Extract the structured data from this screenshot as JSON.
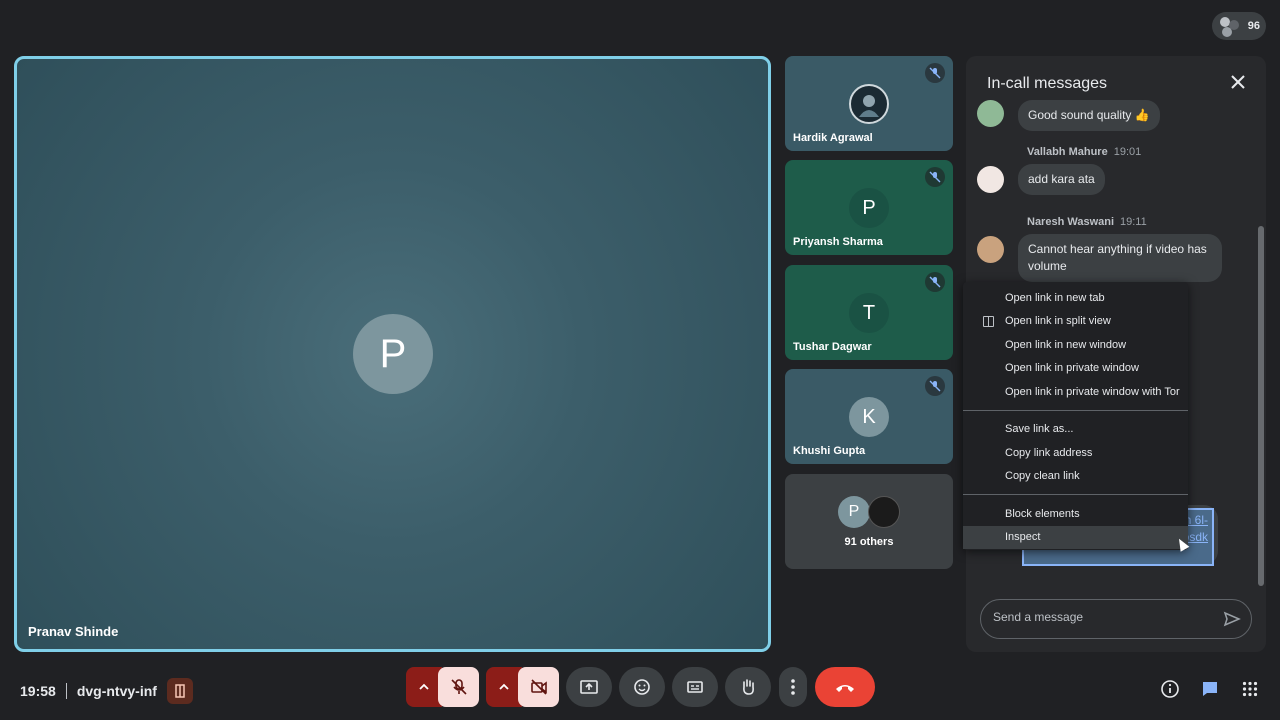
{
  "participants_badge": {
    "count": "96"
  },
  "main_tile": {
    "initial": "P",
    "name": "Pranav Shinde"
  },
  "tiles": [
    {
      "name": "Hardik Agrawal",
      "initial": "",
      "bg": "#3a5a66"
    },
    {
      "name": "Priyansh Sharma",
      "initial": "P",
      "bg": "#1e5c4a"
    },
    {
      "name": "Tushar Dagwar",
      "initial": "T",
      "bg": "#1e5c4a"
    },
    {
      "name": "Khushi Gupta",
      "initial": "K",
      "bg": "#3a5a66"
    }
  ],
  "others_tile": {
    "label": "91 others",
    "initial": "P"
  },
  "chat": {
    "title": "In-call messages",
    "messages": [
      {
        "text": "Good sound quality 👍"
      },
      {
        "sender": "Vallabh Mahure",
        "time": "19:01",
        "text": "add kara ata"
      },
      {
        "sender": "Naresh Waswani",
        "time": "19:11",
        "text": "Cannot hear anything if video has volume"
      }
    ],
    "link_text": "//lhm 6l- ...ujbAmraraakwaraqp=ahosdk",
    "input_placeholder": "Send a message"
  },
  "context_menu": {
    "group1": [
      "Open link in new tab",
      "Open link in split view",
      "Open link in new window",
      "Open link in private window",
      "Open link in private window with Tor"
    ],
    "group2": [
      "Save link as...",
      "Copy link address",
      "Copy clean link"
    ],
    "group3": [
      "Block elements",
      "Inspect"
    ]
  },
  "bottom": {
    "time": "19:58",
    "meeting_code": "dvg-ntvy-inf"
  },
  "colors": {
    "accent": "#8ab4f8",
    "end_call": "#ea4335",
    "tile_green": "#1e5c4a"
  }
}
